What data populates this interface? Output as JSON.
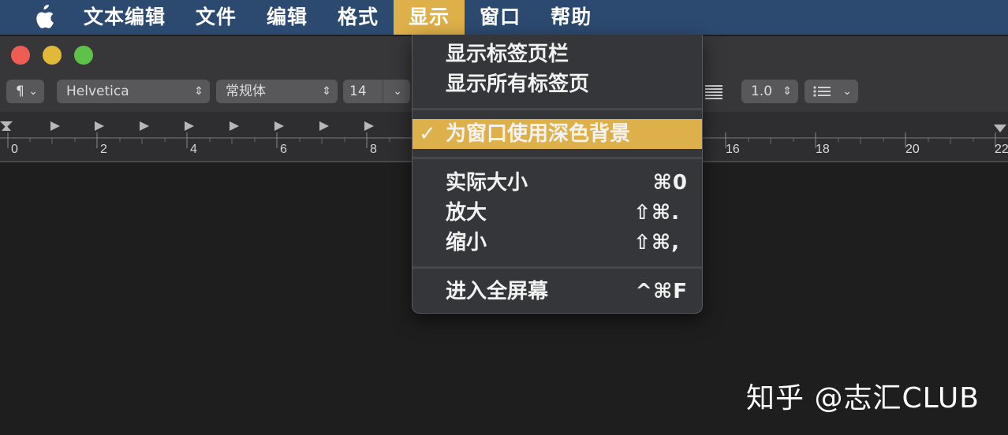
{
  "menubar": {
    "app_icon": "apple-logo-icon",
    "items": [
      "文本编辑",
      "文件",
      "编辑",
      "格式",
      "显示",
      "窗口",
      "帮助"
    ],
    "active_index": 4
  },
  "toolbar": {
    "paragraph_symbol": "¶",
    "font_family": "Helvetica",
    "font_style": "常规体",
    "font_size": "14",
    "line_spacing": "1.0"
  },
  "ruler": {
    "labels": [
      "0",
      "2",
      "4",
      "6",
      "8",
      "16",
      "18",
      "20",
      "22"
    ]
  },
  "dropdown": {
    "items": [
      {
        "label": "显示标签页栏",
        "shortcut": ""
      },
      {
        "label": "显示所有标签页",
        "shortcut": ""
      },
      {
        "label": "为窗口使用深色背景",
        "shortcut": "",
        "checked": true
      },
      {
        "label": "实际大小",
        "shortcut": "⌘0"
      },
      {
        "label": "放大",
        "shortcut": "⇧⌘."
      },
      {
        "label": "缩小",
        "shortcut": "⇧⌘,"
      },
      {
        "label": "进入全屏幕",
        "shortcut": "^⌘F"
      }
    ],
    "check_mark": "✓"
  },
  "colors": {
    "menubar_bg": "#2c4a6f",
    "highlight": "#deb04a",
    "close": "#ee5d54",
    "minimize": "#e0b93a",
    "maximize": "#5ec14a"
  },
  "watermark": "知乎 @志汇CLUB"
}
